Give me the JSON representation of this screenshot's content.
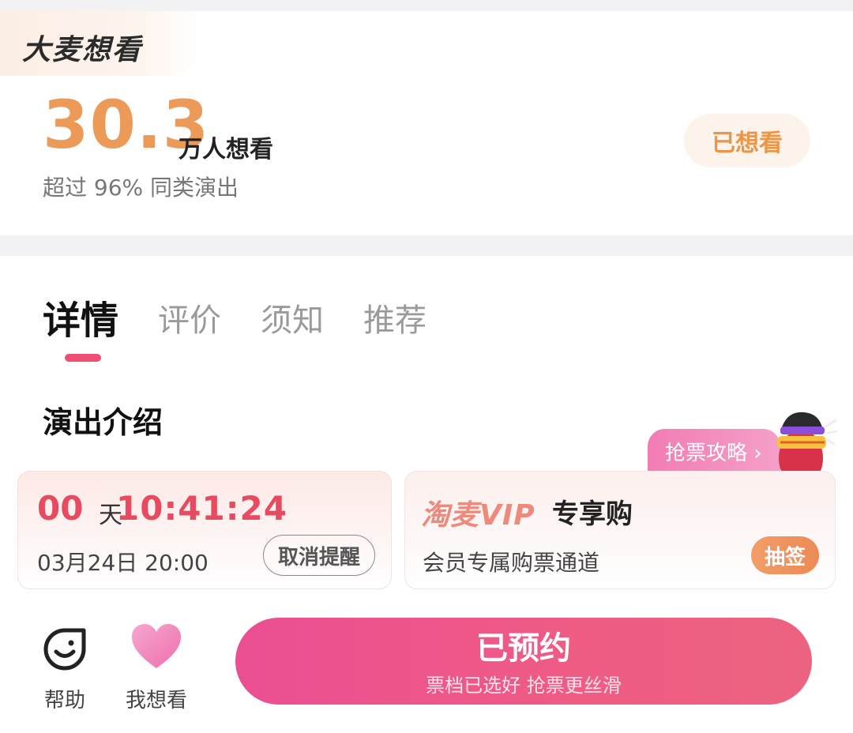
{
  "want_card": {
    "brand": "大麦想看",
    "count": "30.3",
    "count_unit": "万人想看",
    "rank_text": "超过 96% 同类演出",
    "wanted_label": "已想看"
  },
  "tabs": [
    {
      "label": "详情",
      "active": true
    },
    {
      "label": "评价",
      "active": false
    },
    {
      "label": "须知",
      "active": false
    },
    {
      "label": "推荐",
      "active": false
    }
  ],
  "section_title": "演出介绍",
  "strategy_tag": "抢票攻略 ›",
  "countdown": {
    "days": "00",
    "day_unit": "天",
    "time": "10:41:24",
    "date": "03月24日 20:00",
    "cancel_label": "取消提醒"
  },
  "vip": {
    "logo": "淘麦VIP",
    "title": "专享购",
    "desc": "会员专属购票通道",
    "lottery_label": "抽签"
  },
  "bottom_bar": {
    "help_label": "帮助",
    "want_label": "我想看",
    "reserve_main": "已预约",
    "reserve_sub": "票档已选好 抢票更丝滑"
  },
  "colors": {
    "accent_orange": "#ec9a58",
    "accent_pink": "#ee4f75",
    "countdown_red": "#e84a5f",
    "reserve_gradient_start": "#ea4f92",
    "reserve_gradient_end": "#ec6380"
  },
  "icons": {
    "help": "smiley-help-icon",
    "want": "heart-icon",
    "mascot": "mascot-icon"
  }
}
